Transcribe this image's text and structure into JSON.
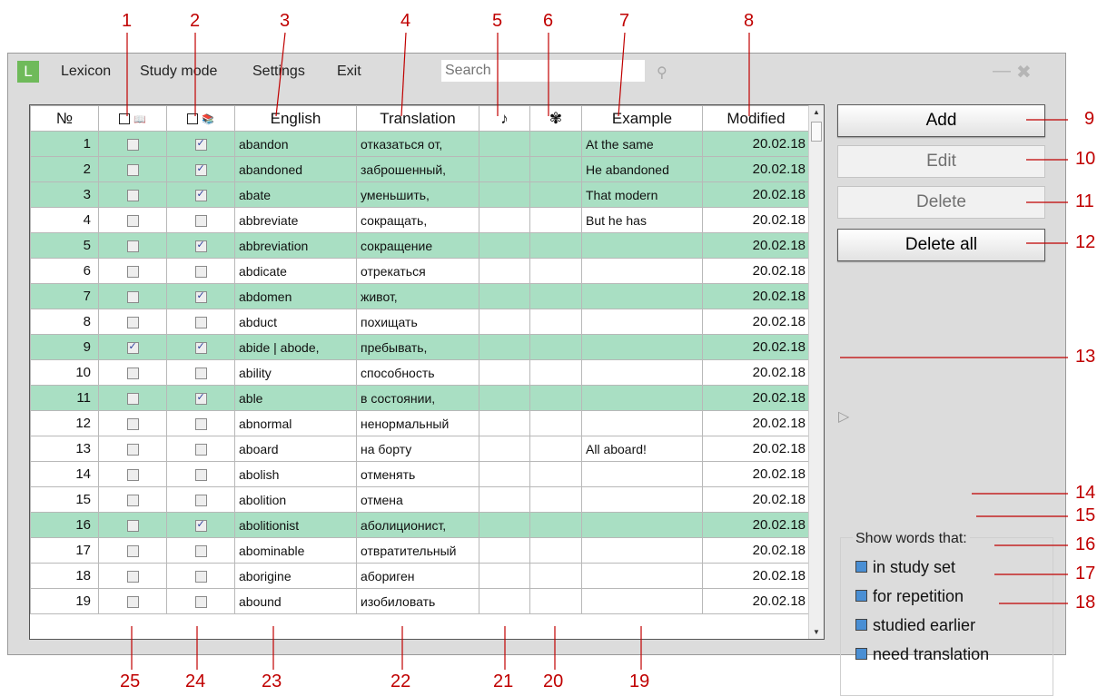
{
  "menu": {
    "logo": "L",
    "items": [
      "Lexicon",
      "Study mode",
      "Settings",
      "Exit"
    ],
    "search_placeholder": "Search"
  },
  "columns": {
    "num": "№",
    "english": "English",
    "translation": "Translation",
    "sound": "♪",
    "image": "✾",
    "example": "Example",
    "modified": "Modified"
  },
  "rows": [
    {
      "n": "1",
      "study": false,
      "repeat": true,
      "en": "abandon",
      "tr": "отказаться от,",
      "ex": "At the same",
      "mod": "20.02.18",
      "hl": true
    },
    {
      "n": "2",
      "study": false,
      "repeat": true,
      "en": "abandoned",
      "tr": "заброшенный,",
      "ex": "He abandoned",
      "mod": "20.02.18",
      "hl": true
    },
    {
      "n": "3",
      "study": false,
      "repeat": true,
      "en": "abate",
      "tr": "уменьшить,",
      "ex": "That modern",
      "mod": "20.02.18",
      "hl": true
    },
    {
      "n": "4",
      "study": false,
      "repeat": false,
      "en": "abbreviate",
      "tr": "сокращать,",
      "ex": "But he has",
      "mod": "20.02.18",
      "hl": false
    },
    {
      "n": "5",
      "study": false,
      "repeat": true,
      "en": "abbreviation",
      "tr": "сокращение",
      "ex": "",
      "mod": "20.02.18",
      "hl": true
    },
    {
      "n": "6",
      "study": false,
      "repeat": false,
      "en": "abdicate",
      "tr": "отрекаться",
      "ex": "",
      "mod": "20.02.18",
      "hl": false
    },
    {
      "n": "7",
      "study": false,
      "repeat": true,
      "en": "abdomen",
      "tr": "живот,",
      "ex": "",
      "mod": "20.02.18",
      "hl": true
    },
    {
      "n": "8",
      "study": false,
      "repeat": false,
      "en": "abduct",
      "tr": "похищать",
      "ex": "",
      "mod": "20.02.18",
      "hl": false
    },
    {
      "n": "9",
      "study": true,
      "repeat": true,
      "en": "abide | abode,",
      "tr": "пребывать,",
      "ex": "",
      "mod": "20.02.18",
      "hl": true
    },
    {
      "n": "10",
      "study": false,
      "repeat": false,
      "en": "ability",
      "tr": "способность",
      "ex": "",
      "mod": "20.02.18",
      "hl": false
    },
    {
      "n": "11",
      "study": false,
      "repeat": true,
      "en": "able",
      "tr": "в состоянии,",
      "ex": "",
      "mod": "20.02.18",
      "hl": true
    },
    {
      "n": "12",
      "study": false,
      "repeat": false,
      "en": "abnormal",
      "tr": "ненормальный",
      "ex": "",
      "mod": "20.02.18",
      "hl": false
    },
    {
      "n": "13",
      "study": false,
      "repeat": false,
      "en": "aboard",
      "tr": "на борту",
      "ex": "All aboard!",
      "mod": "20.02.18",
      "hl": false
    },
    {
      "n": "14",
      "study": false,
      "repeat": false,
      "en": "abolish",
      "tr": "отменять",
      "ex": "",
      "mod": "20.02.18",
      "hl": false
    },
    {
      "n": "15",
      "study": false,
      "repeat": false,
      "en": "abolition",
      "tr": "отмена",
      "ex": "",
      "mod": "20.02.18",
      "hl": false
    },
    {
      "n": "16",
      "study": false,
      "repeat": true,
      "en": "abolitionist",
      "tr": "аболиционист,",
      "ex": "",
      "mod": "20.02.18",
      "hl": true
    },
    {
      "n": "17",
      "study": false,
      "repeat": false,
      "en": "abominable",
      "tr": "отвратительный",
      "ex": "",
      "mod": "20.02.18",
      "hl": false
    },
    {
      "n": "18",
      "study": false,
      "repeat": false,
      "en": "aborigine",
      "tr": "абориген",
      "ex": "",
      "mod": "20.02.18",
      "hl": false
    },
    {
      "n": "19",
      "study": false,
      "repeat": false,
      "en": "abound",
      "tr": "изобиловать",
      "ex": "",
      "mod": "20.02.18",
      "hl": false
    }
  ],
  "buttons": {
    "add": "Add",
    "edit": "Edit",
    "delete": "Delete",
    "delete_all": "Delete all"
  },
  "filters": {
    "title": "Show words that:",
    "items": [
      "in study set",
      "for repetition",
      "studied earlier",
      "need translation"
    ]
  },
  "callouts": [
    "1",
    "2",
    "3",
    "4",
    "5",
    "6",
    "7",
    "8",
    "9",
    "10",
    "11",
    "12",
    "13",
    "14",
    "15",
    "16",
    "17",
    "18",
    "19",
    "20",
    "21",
    "22",
    "23",
    "24",
    "25"
  ],
  "colors": {
    "accent": "#c00000",
    "row_highlight": "#a9dfc3",
    "window_bg": "#dcdcdc",
    "logo": "#6fba5a"
  }
}
